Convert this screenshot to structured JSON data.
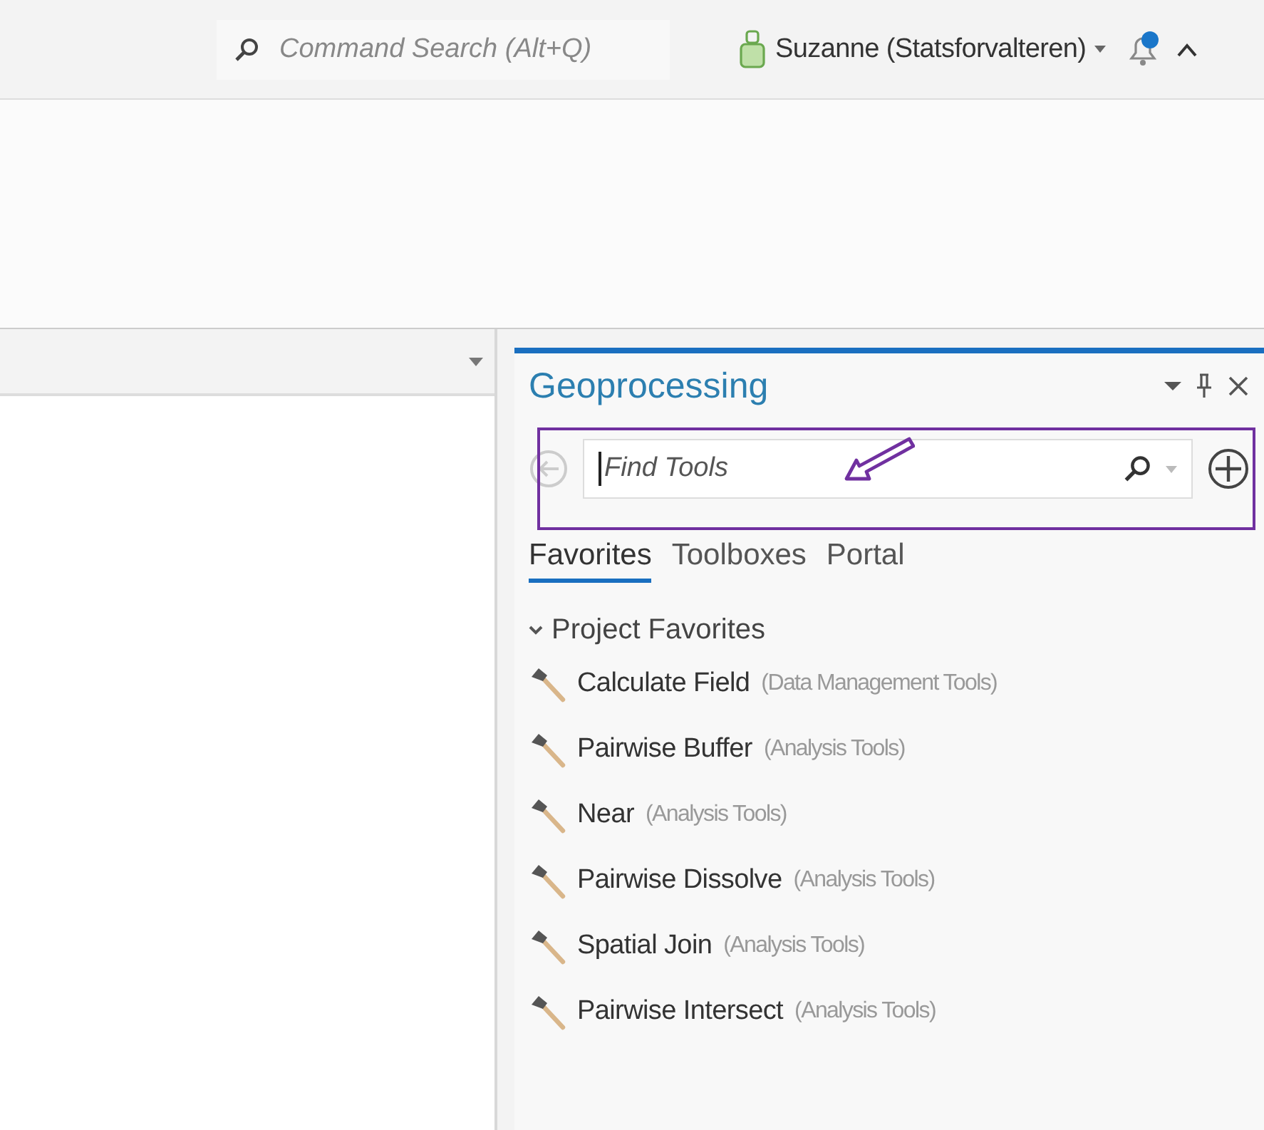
{
  "topbar": {
    "search": {
      "placeholder": "Command Search (Alt+Q)"
    },
    "user": "Suzanne (Statsforvalteren)",
    "notification": true
  },
  "panel": {
    "title": "Geoprocessing",
    "find": {
      "placeholder": "Find Tools"
    },
    "tabs": [
      {
        "label": "Favorites",
        "selected": true
      },
      {
        "label": "Toolboxes",
        "selected": false
      },
      {
        "label": "Portal",
        "selected": false
      }
    ],
    "group": {
      "label": "Project Favorites",
      "expanded": true,
      "tools": [
        {
          "name": "Calculate Field",
          "category": "(Data Management Tools)"
        },
        {
          "name": "Pairwise Buffer",
          "category": "(Analysis Tools)"
        },
        {
          "name": "Near",
          "category": "(Analysis Tools)"
        },
        {
          "name": "Pairwise Dissolve",
          "category": "(Analysis Tools)"
        },
        {
          "name": "Spatial Join",
          "category": "(Analysis Tools)"
        },
        {
          "name": "Pairwise Intersect",
          "category": "(Analysis Tools)"
        }
      ]
    }
  }
}
